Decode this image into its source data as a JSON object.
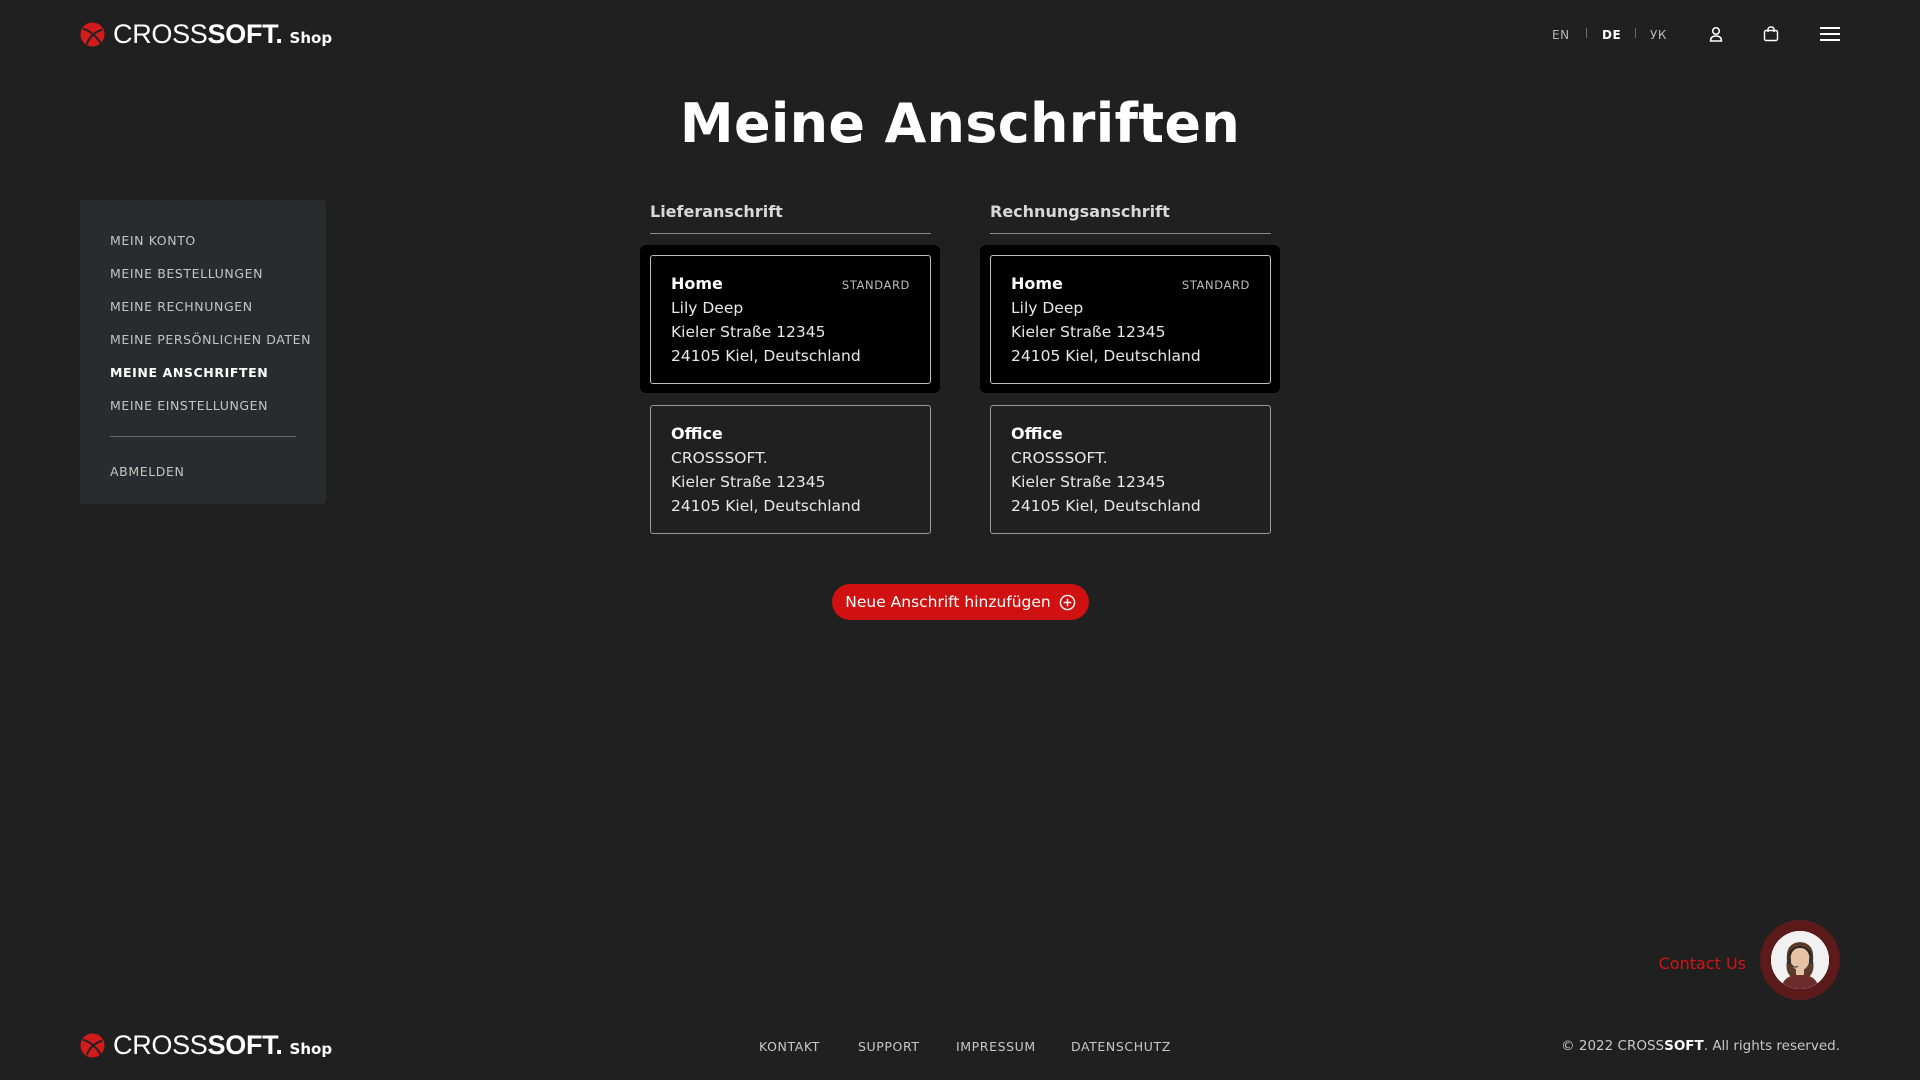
{
  "header": {
    "logo": {
      "cross": "CROSS",
      "soft": "SOFT.",
      "shop": "Shop"
    },
    "languages": [
      {
        "label": "EN",
        "active": false
      },
      {
        "label": "DE",
        "active": true
      },
      {
        "label": "УК",
        "active": false
      }
    ],
    "icons": [
      "user-icon",
      "shopping-bag-icon",
      "menu-icon"
    ]
  },
  "page": {
    "title": "Meine Anschriften"
  },
  "sidebar": {
    "items": [
      {
        "label": "MEIN KONTO"
      },
      {
        "label": "MEINE BESTELLUNGEN"
      },
      {
        "label": "MEINE RECHNUNGEN"
      },
      {
        "label": "MEINE PERSÖNLICHEN DATEN"
      },
      {
        "label": "MEINE ANSCHRIFTEN",
        "active": true
      },
      {
        "label": "MEINE EINSTELLUNGEN"
      }
    ],
    "logout": "ABMELDEN"
  },
  "columns": [
    {
      "title": "Lieferanschrift",
      "cards": [
        {
          "name": "Home",
          "badge": "STANDARD",
          "lines": [
            "Lily Deep",
            "Kieler Straße 12345",
            "24105 Kiel, Deutschland"
          ],
          "selected": true
        },
        {
          "name": "Office",
          "badge": "",
          "lines": [
            "CROSSSOFT.",
            "Kieler Straße 12345",
            "24105 Kiel, Deutschland"
          ],
          "selected": false
        }
      ]
    },
    {
      "title": "Rechnungsanschrift",
      "cards": [
        {
          "name": "Home",
          "badge": "STANDARD",
          "lines": [
            "Lily Deep",
            "Kieler Straße 12345",
            "24105 Kiel, Deutschland"
          ],
          "selected": true
        },
        {
          "name": "Office",
          "badge": "",
          "lines": [
            "CROSSSOFT.",
            "Kieler Straße 12345",
            "24105 Kiel, Deutschland"
          ],
          "selected": false
        }
      ]
    }
  ],
  "add_button": {
    "label": "Neue Anschrift hinzufügen",
    "icon": "plus-circle-icon"
  },
  "contact": {
    "label": "Contact Us",
    "icon": "support-agent-avatar"
  },
  "footer": {
    "links": [
      "KONTAKT",
      "SUPPORT",
      "IMPRESSUM",
      "DATENSCHUTZ"
    ],
    "copyright_prefix": "© 2022 CROSS",
    "copyright_brand": "SOFT",
    "copyright_suffix": ". All rights reserved."
  },
  "colors": {
    "background": "#202020",
    "accent": "#cf1111",
    "sidebar": "#2a2b2e"
  }
}
